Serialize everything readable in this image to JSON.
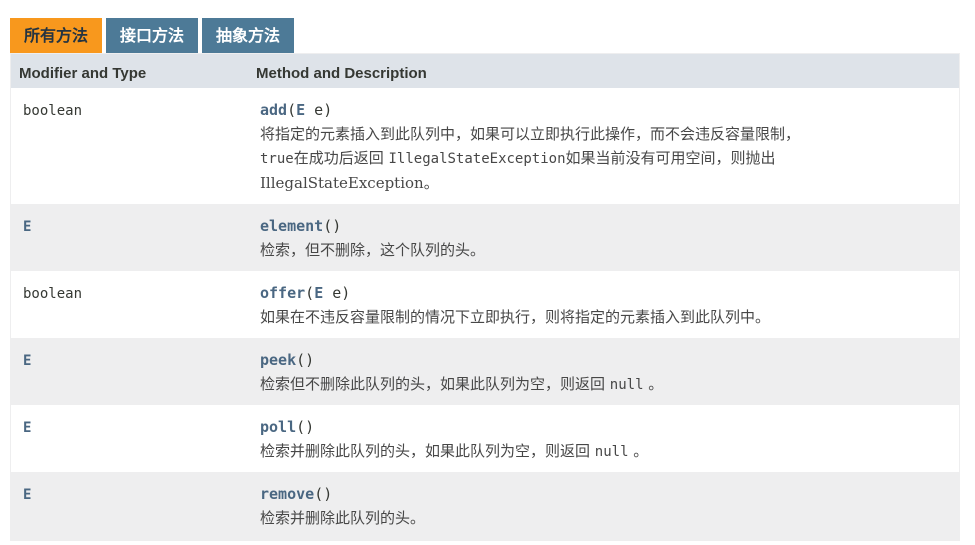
{
  "tabs": [
    {
      "label": "所有方法",
      "active": true
    },
    {
      "label": "接口方法",
      "active": false
    },
    {
      "label": "抽象方法",
      "active": false
    }
  ],
  "table": {
    "headers": {
      "type": "Modifier and Type",
      "method": "Method and Description"
    },
    "rows": [
      {
        "type": "boolean",
        "name": "add",
        "sig_open": "(",
        "param_type": "E",
        "param_name": " e)",
        "desc_l1": "将指定的元素插入到此队列中，如果可以立即执行此操作，而不会违反容量限制，",
        "desc_l2_mono": "true",
        "desc_l2_a": "在成功后返回 ",
        "desc_l2_mono2": "IllegalStateException",
        "desc_l2_b": "如果当前没有可用空间，则抛出",
        "desc_l3": "IllegalStateException。"
      },
      {
        "type": "E",
        "name": "element",
        "sig_close": "()",
        "desc": "检索，但不删除，这个队列的头。"
      },
      {
        "type": "boolean",
        "name": "offer",
        "sig_open": "(",
        "param_type": "E",
        "param_name": " e)",
        "desc": "如果在不违反容量限制的情况下立即执行，则将指定的元素插入到此队列中。"
      },
      {
        "type": "E",
        "name": "peek",
        "sig_close": "()",
        "desc_a": "检索但不删除此队列的头，如果此队列为空，则返回 ",
        "desc_mono": "null",
        "desc_b": " 。"
      },
      {
        "type": "E",
        "name": "poll",
        "sig_close": "()",
        "desc_a": "检索并删除此队列的头，如果此队列为空，则返回 ",
        "desc_mono": "null",
        "desc_b": " 。"
      },
      {
        "type": "E",
        "name": "remove",
        "sig_close": "()",
        "desc": "检索并删除此队列的头。"
      }
    ]
  }
}
